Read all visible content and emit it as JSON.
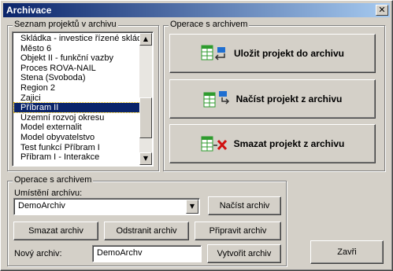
{
  "window": {
    "title": "Archivace",
    "close_glyph": "✕"
  },
  "project_list": {
    "legend": "Seznam projektů v archivu",
    "items": [
      "Skládka - investice řízené skládk",
      "Město 6",
      "Objekt II - funkční vazby",
      "Proces ROVA-NAIL",
      "Stena (Svoboda)",
      "Region 2",
      "Zajici",
      "Příbram II",
      "Územní rozvoj okresu",
      "Model externalit",
      "Model obyvatelstvo",
      "Test funkcí Příbram I",
      "Příbram I - Interakce"
    ],
    "selected": "Příbram II",
    "scroll_up_glyph": "▲",
    "scroll_down_glyph": "▼"
  },
  "archive_ops": {
    "legend": "Operace s archivem",
    "save_label": "Uložit projekt do archivu",
    "save_icon": "table-export-icon",
    "load_label": "Načíst projekt z archivu",
    "load_icon": "table-import-icon",
    "delete_label": "Smazat projekt z archivu",
    "delete_icon": "table-delete-icon"
  },
  "archive_panel": {
    "legend": "Operace s archivem",
    "location_label": "Umístění archívu:",
    "location_value": "DemoArchiv",
    "dropdown_glyph": "▼",
    "load_archive_label": "Načíst archiv",
    "delete_archive_label": "Smazat archiv",
    "remove_archive_label": "Odstranit archiv",
    "prepare_archive_label": "Připravit archiv",
    "new_archive_label": "Nový archiv:",
    "new_archive_value": "DemoArchv",
    "create_archive_label": "Vytvořit archiv"
  },
  "close_button_label": "Zavři",
  "colors": {
    "titlebar_start": "#0a246a",
    "titlebar_end": "#a6caf0",
    "dialog_face": "#d4d0c8",
    "selection": "#0a246a",
    "icon_green": "#2e9b2e",
    "icon_blue": "#1f6fd1",
    "icon_red": "#d01010"
  }
}
